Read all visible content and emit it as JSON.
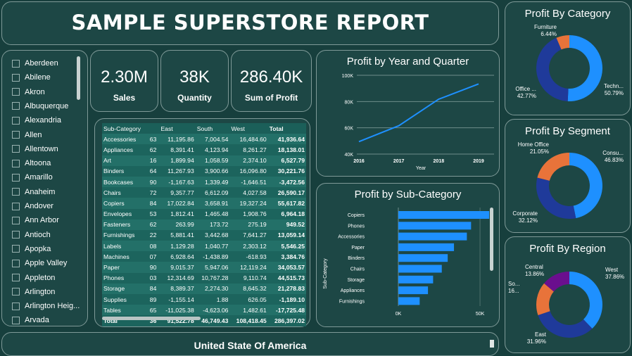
{
  "title": "SAMPLE SUPERSTORE REPORT",
  "slicer": {
    "items": [
      "Aberdeen",
      "Abilene",
      "Akron",
      "Albuquerque",
      "Alexandria",
      "Allen",
      "Allentown",
      "Altoona",
      "Amarillo",
      "Anaheim",
      "Andover",
      "Ann Arbor",
      "Antioch",
      "Apopka",
      "Apple Valley",
      "Appleton",
      "Arlington",
      "Arlington Heig...",
      "Arvada"
    ]
  },
  "kpis": [
    {
      "value": "2.30M",
      "label": "Sales"
    },
    {
      "value": "38K",
      "label": "Quantity"
    },
    {
      "value": "286.40K",
      "label": "Sum of Profit"
    }
  ],
  "table": {
    "headers": [
      "Sub-Category",
      "",
      "East",
      "South",
      "West",
      "Total"
    ],
    "rows": [
      [
        "Accessories",
        "63",
        "11,195.86",
        "7,004.54",
        "16,484.60",
        "41,936.64"
      ],
      [
        "Appliances",
        "62",
        "8,391.41",
        "4,123.94",
        "8,261.27",
        "18,138.01"
      ],
      [
        "Art",
        "16",
        "1,899.94",
        "1,058.59",
        "2,374.10",
        "6,527.79"
      ],
      [
        "Binders",
        "64",
        "11,267.93",
        "3,900.66",
        "16,096.80",
        "30,221.76"
      ],
      [
        "Bookcases",
        "90",
        "-1,167.63",
        "1,339.49",
        "-1,646.51",
        "-3,472.56"
      ],
      [
        "Chairs",
        "72",
        "9,357.77",
        "6,612.09",
        "4,027.58",
        "26,590.17"
      ],
      [
        "Copiers",
        "84",
        "17,022.84",
        "3,658.91",
        "19,327.24",
        "55,617.82"
      ],
      [
        "Envelopes",
        "53",
        "1,812.41",
        "1,465.48",
        "1,908.76",
        "6,964.18"
      ],
      [
        "Fasteners",
        "62",
        "263.99",
        "173.72",
        "275.19",
        "949.52"
      ],
      [
        "Furnishings",
        "22",
        "5,881.41",
        "3,442.68",
        "7,641.27",
        "13,059.14"
      ],
      [
        "Labels",
        "08",
        "1,129.28",
        "1,040.77",
        "2,303.12",
        "5,546.25"
      ],
      [
        "Machines",
        "07",
        "6,928.64",
        "-1,438.89",
        "-618.93",
        "3,384.76"
      ],
      [
        "Paper",
        "90",
        "9,015.37",
        "5,947.06",
        "12,119.24",
        "34,053.57"
      ],
      [
        "Phones",
        "03",
        "12,314.69",
        "10,767.28",
        "9,110.74",
        "44,515.73"
      ],
      [
        "Storage",
        "84",
        "8,389.37",
        "2,274.30",
        "8,645.32",
        "21,278.83"
      ],
      [
        "Supplies",
        "89",
        "-1,155.14",
        "1.88",
        "626.05",
        "-1,189.10"
      ],
      [
        "Tables",
        "65",
        "-11,025.38",
        "-4,623.06",
        "1,482.61",
        "-17,725.48"
      ]
    ],
    "total": [
      "Total",
      "36",
      "91,522.78",
      "46,749.43",
      "108,418.45",
      "286,397.02"
    ]
  },
  "line_chart": {
    "title": "Profit by Year and Quarter",
    "x": [
      "2016",
      "2017",
      "2018",
      "2019"
    ],
    "xlabel": "Year",
    "yticks": [
      "100K",
      "80K",
      "60K",
      "40K"
    ]
  },
  "bar_chart": {
    "title": "Profit by Sub-Category",
    "ylabel": "Sub-Category",
    "xticks": [
      "0K",
      "50K"
    ]
  },
  "footer": "United State Of America",
  "colors": {
    "blue": "#1e90ff",
    "navy": "#1f3a9a",
    "orange": "#e8733a",
    "purple": "#6a0f8e"
  },
  "donuts": [
    {
      "title": "Profit By Category",
      "slices": [
        {
          "label": "Technology",
          "pct": "50.79%",
          "short": "Techn...",
          "color": "#1e90ff"
        },
        {
          "label": "Office Supplies",
          "pct": "42.77%",
          "short": "Office ...",
          "color": "#1f3a9a"
        },
        {
          "label": "Furniture",
          "pct": "6.44%",
          "short": "Furniture",
          "color": "#e8733a"
        }
      ]
    },
    {
      "title": "Profit By Segment",
      "slices": [
        {
          "label": "Consumer",
          "pct": "46.83%",
          "short": "Consu...",
          "color": "#1e90ff"
        },
        {
          "label": "Corporate",
          "pct": "32.12%",
          "short": "Corporate",
          "color": "#1f3a9a"
        },
        {
          "label": "Home Office",
          "pct": "21.05%",
          "short": "Home Office",
          "color": "#e8733a"
        }
      ]
    },
    {
      "title": "Profit By Region",
      "slices": [
        {
          "label": "West",
          "pct": "37.86%",
          "short": "West",
          "color": "#1e90ff"
        },
        {
          "label": "East",
          "pct": "31.96%",
          "short": "East",
          "color": "#1f3a9a"
        },
        {
          "label": "South",
          "pct": "16...",
          "short": "So...",
          "color": "#e8733a"
        },
        {
          "label": "Central",
          "pct": "13.86%",
          "short": "Central",
          "color": "#6a0f8e"
        }
      ]
    }
  ],
  "chart_data": [
    {
      "type": "line",
      "title": "Profit by Year and Quarter",
      "xlabel": "Year",
      "x": [
        "2016",
        "2017",
        "2018",
        "2019"
      ],
      "values": [
        49500,
        61600,
        81800,
        93400
      ],
      "ylim": [
        40000,
        100000
      ]
    },
    {
      "type": "bar",
      "title": "Profit by Sub-Category",
      "ylabel": "Sub-Category",
      "categories": [
        "Copiers",
        "Phones",
        "Accessories",
        "Paper",
        "Binders",
        "Chairs",
        "Storage",
        "Appliances",
        "Furnishings"
      ],
      "values": [
        55617.82,
        44515.73,
        41936.64,
        34053.57,
        30221.76,
        26590.17,
        21278.83,
        18138.01,
        13059.14
      ],
      "xlim": [
        0,
        60000
      ]
    },
    {
      "type": "pie",
      "title": "Profit By Category",
      "categories": [
        "Technology",
        "Office Supplies",
        "Furniture"
      ],
      "values": [
        50.79,
        42.77,
        6.44
      ]
    },
    {
      "type": "pie",
      "title": "Profit By Segment",
      "categories": [
        "Consumer",
        "Corporate",
        "Home Office"
      ],
      "values": [
        46.83,
        32.12,
        21.05
      ]
    },
    {
      "type": "pie",
      "title": "Profit By Region",
      "categories": [
        "West",
        "East",
        "South",
        "Central"
      ],
      "values": [
        37.86,
        31.96,
        16.32,
        13.86
      ]
    }
  ]
}
